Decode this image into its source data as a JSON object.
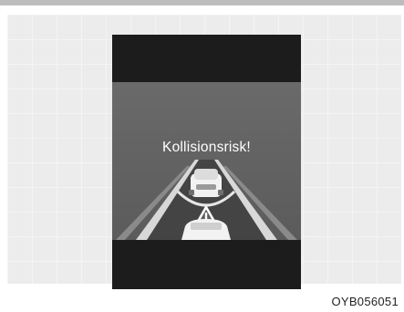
{
  "display": {
    "warning_message": "Kollisionsrisk!"
  },
  "figure": {
    "code": "OYB056051"
  },
  "icons": {
    "warning": "warning-triangle-icon",
    "front_car": "front-car-icon",
    "own_car": "own-car-icon"
  }
}
